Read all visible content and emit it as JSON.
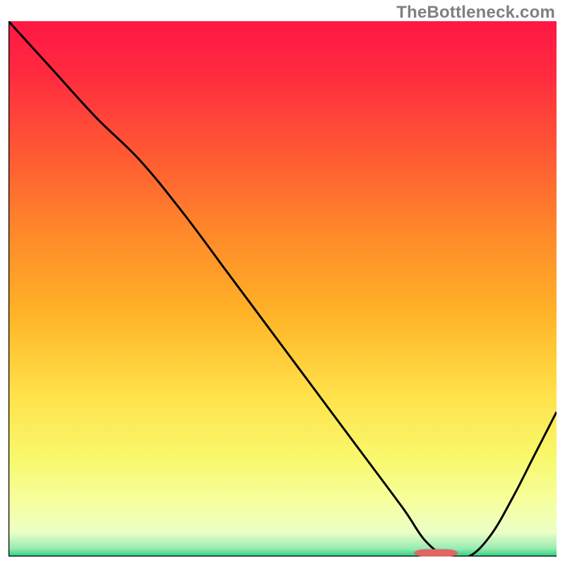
{
  "watermark": "TheBottleneck.com",
  "chart_data": {
    "type": "line",
    "title": "",
    "xlabel": "",
    "ylabel": "",
    "xlim": [
      0,
      100
    ],
    "ylim": [
      0,
      100
    ],
    "grid": false,
    "legend": false,
    "series": [
      {
        "name": "bottleneck-curve",
        "x": [
          0,
          8,
          16,
          24,
          32,
          40,
          48,
          56,
          64,
          72,
          76,
          80,
          84,
          88,
          92,
          96,
          100
        ],
        "values": [
          100,
          91,
          82,
          74,
          64,
          53,
          42,
          31,
          20,
          9,
          3,
          0,
          0,
          4,
          11,
          19,
          27
        ]
      }
    ],
    "marker": {
      "name": "optimal-marker",
      "x_center": 78,
      "width": 8,
      "y": 0.6,
      "rx": 2.3
    },
    "gradient_stops": [
      {
        "offset": 0.0,
        "color": "#ff1744"
      },
      {
        "offset": 0.1,
        "color": "#ff2b3f"
      },
      {
        "offset": 0.25,
        "color": "#ff5a33"
      },
      {
        "offset": 0.4,
        "color": "#ff8a2a"
      },
      {
        "offset": 0.55,
        "color": "#ffb428"
      },
      {
        "offset": 0.7,
        "color": "#ffe24a"
      },
      {
        "offset": 0.82,
        "color": "#f8f96e"
      },
      {
        "offset": 0.9,
        "color": "#f5ffa0"
      },
      {
        "offset": 0.955,
        "color": "#ecffc6"
      },
      {
        "offset": 0.985,
        "color": "#97ebb1"
      },
      {
        "offset": 1.0,
        "color": "#28d17c"
      }
    ]
  }
}
